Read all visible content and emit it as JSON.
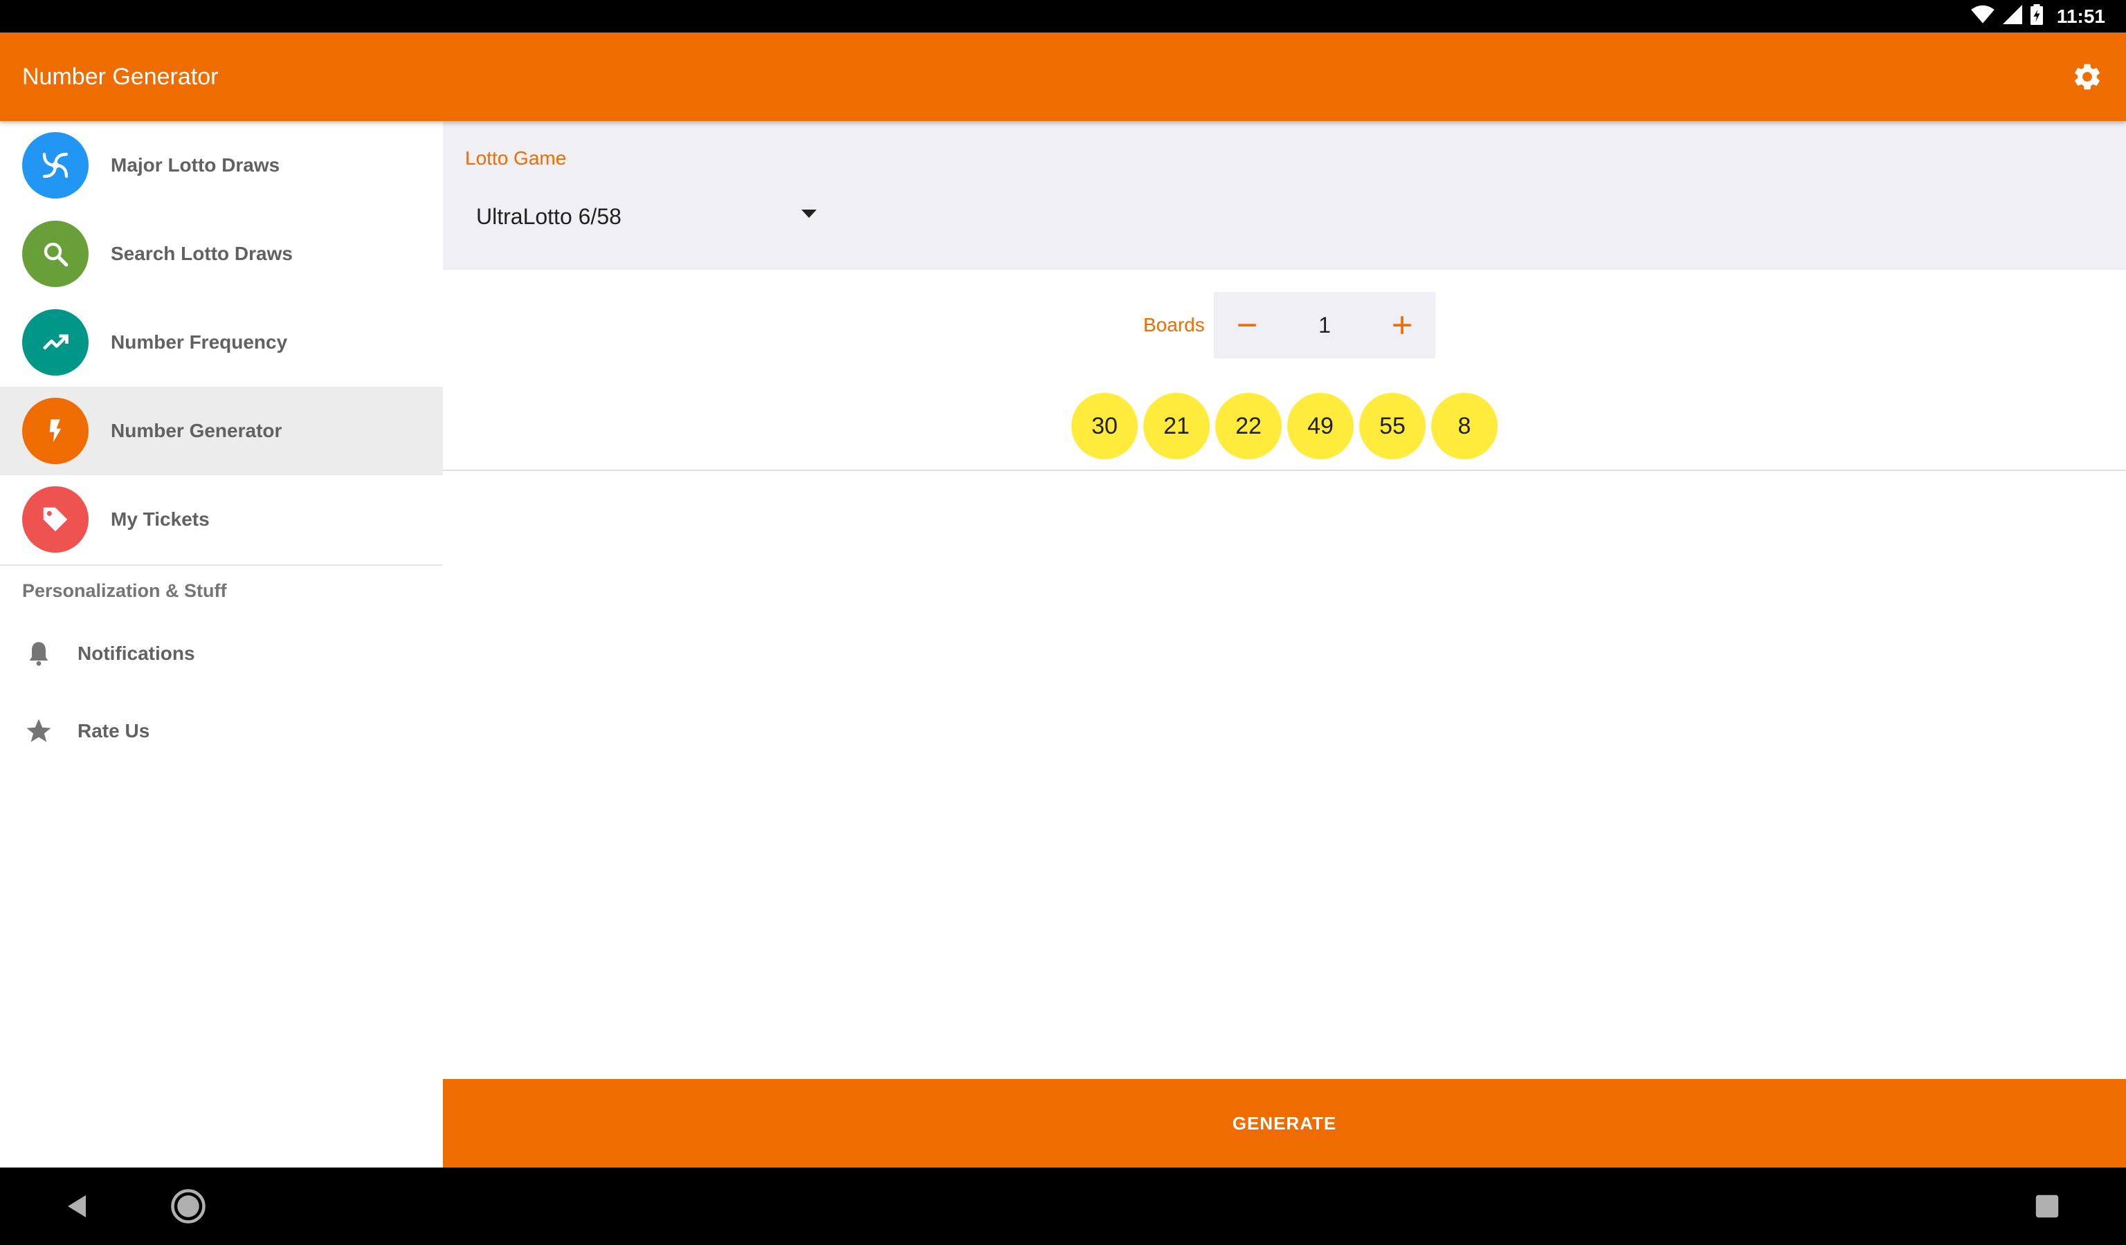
{
  "status_bar": {
    "time": "11:51"
  },
  "app_bar": {
    "title": "Number Generator"
  },
  "drawer": {
    "items": [
      {
        "label": "Major Lotto Draws",
        "icon": "spiral-icon",
        "color": "#2196f3"
      },
      {
        "label": "Search Lotto Draws",
        "icon": "search-icon",
        "color": "#689f38"
      },
      {
        "label": "Number Frequency",
        "icon": "trending-up-icon",
        "color": "#009688"
      },
      {
        "label": "Number Generator",
        "icon": "flash-icon",
        "color": "#ef6c00",
        "active": true
      },
      {
        "label": "My Tickets",
        "icon": "tag-icon",
        "color": "#ef5350"
      }
    ],
    "section_header": "Personalization & Stuff",
    "secondary_items": [
      {
        "label": "Notifications",
        "icon": "bell-icon"
      },
      {
        "label": "Rate Us",
        "icon": "star-icon"
      }
    ]
  },
  "main": {
    "game_label": "Lotto Game",
    "game_value": "UltraLotto 6/58",
    "boards_label": "Boards",
    "boards_value": "1",
    "numbers": [
      "30",
      "21",
      "22",
      "49",
      "55",
      "8"
    ],
    "generate_label": "GENERATE"
  },
  "colors": {
    "accent": "#ef6c00",
    "ball": "#ffeb3b",
    "panel": "#efeff4"
  }
}
